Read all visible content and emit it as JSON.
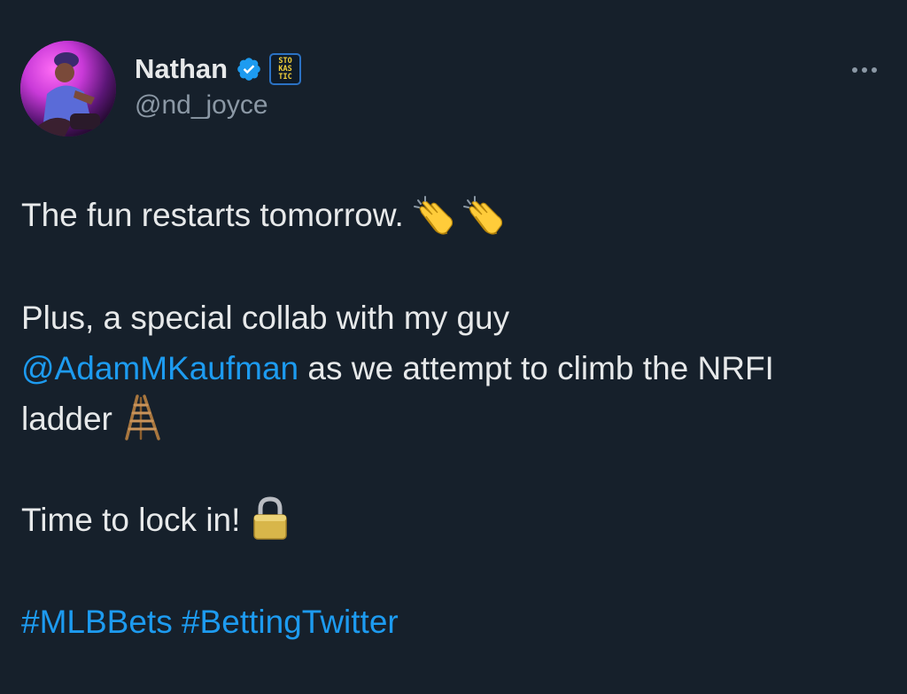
{
  "tweet": {
    "author": {
      "display_name": "Nathan",
      "handle": "@nd_joyce",
      "verified": true,
      "org_badge_lines": [
        "STO",
        "KAS",
        "TIC"
      ]
    },
    "text": {
      "line1": "The fun restarts tomorrow.",
      "line2": "Plus, a special collab with my guy",
      "mention": "@AdamMKaufman",
      "line3_rest": " as we attempt to climb the NRFI",
      "line4": "ladder",
      "line5": "Time to lock in!",
      "hashtag1": "#MLBBets",
      "hashtag2": "#BettingTwitter"
    },
    "emojis": [
      "clapping-hands",
      "clapping-hands",
      "ladder",
      "locked"
    ]
  },
  "colors": {
    "background": "#16202b",
    "text": "#e7e9ea",
    "secondary_text": "#8b98a5",
    "link": "#1d9bf0",
    "verified": "#1d9bf0"
  }
}
